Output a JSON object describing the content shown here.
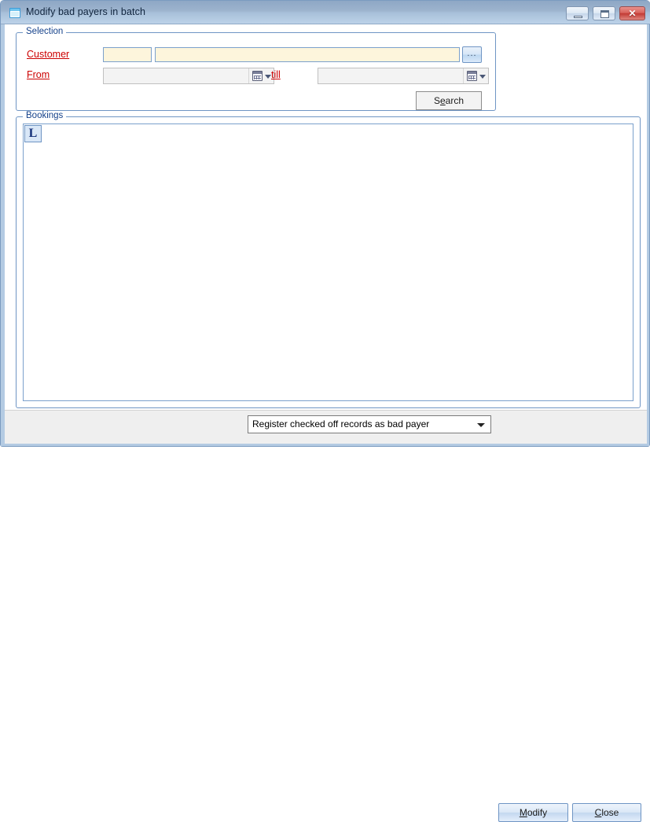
{
  "window": {
    "title": "Modify bad payers in batch",
    "icon": "window-icon",
    "caption_buttons": {
      "minimize": "minimize-icon",
      "maximize": "maximize-icon",
      "close": "✕"
    },
    "colors": {
      "titlebar_top": "#8ea7c5",
      "titlebar_bottom": "#bcd2e8",
      "frame": "#b4cbe3",
      "link_label": "#cc0000",
      "group_caption": "#15428b",
      "input_background": "#fdf5dc",
      "input_border": "#7ba0cc",
      "disabled_field": "#f3f3f3",
      "bottom_bar": "#efefef"
    }
  },
  "selection": {
    "caption": "Selection",
    "customer": {
      "label": "Customer",
      "code_value": "",
      "code_placeholder": "",
      "name_value": "",
      "name_placeholder": "",
      "browse_label": "..."
    },
    "from": {
      "label": "From",
      "value": "",
      "calendar_icon": "calendar-icon",
      "dropdown_icon": "chevron-down-icon"
    },
    "till": {
      "label": "till",
      "value": "",
      "calendar_icon": "calendar-icon",
      "dropdown_icon": "chevron-down-icon"
    },
    "search_button": {
      "prefix": "S",
      "accel": "e",
      "suffix": "arch"
    }
  },
  "bookings": {
    "caption": "Bookings",
    "corner_button_label": "L",
    "rows": []
  },
  "bottom_bar": {
    "action_select": {
      "selected": "Register checked off records as bad payer",
      "options": [
        "Register checked off records as bad payer"
      ],
      "arrow_icon": "chevron-down-icon"
    },
    "modify_button": {
      "prefix": "",
      "accel": "M",
      "suffix": "odify"
    },
    "close_button": {
      "prefix": "",
      "accel": "C",
      "suffix": "lose"
    }
  }
}
